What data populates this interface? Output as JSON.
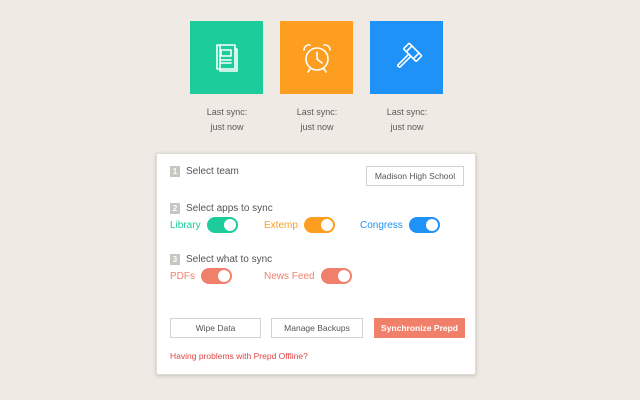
{
  "colors": {
    "library": "#1ccc9a",
    "extemp": "#fe9e20",
    "congress": "#1f92f8",
    "pdfs": "#f0806a",
    "news_feed": "#f0806a",
    "synchronize": "#f0806a",
    "help_link": "#e04545"
  },
  "apps": {
    "library": {
      "icon": "book-icon",
      "sync_line1": "Last sync:",
      "sync_line2": "just now"
    },
    "extemp": {
      "icon": "alarm-clock-icon",
      "sync_line1": "Last sync:",
      "sync_line2": "just now"
    },
    "congress": {
      "icon": "gavel-icon",
      "sync_line1": "Last sync:",
      "sync_line2": "just now"
    }
  },
  "steps": {
    "team": {
      "number": "1",
      "label": "Select team",
      "team_name": "Madison High School"
    },
    "apps": {
      "number": "2",
      "label": "Select apps to sync",
      "library_label": "Library",
      "extemp_label": "Extemp",
      "congress_label": "Congress",
      "library_on": true,
      "extemp_on": true,
      "congress_on": true
    },
    "content": {
      "number": "3",
      "label": "Select what to sync",
      "pdfs_label": "PDFs",
      "news_feed_label": "News Feed",
      "pdfs_on": true,
      "news_feed_on": true
    }
  },
  "actions": {
    "wipe": "Wipe Data",
    "backups": "Manage Backups",
    "synchronize": "Synchronize Prepd"
  },
  "help": {
    "text": "Having problems with Prepd Offline?"
  }
}
